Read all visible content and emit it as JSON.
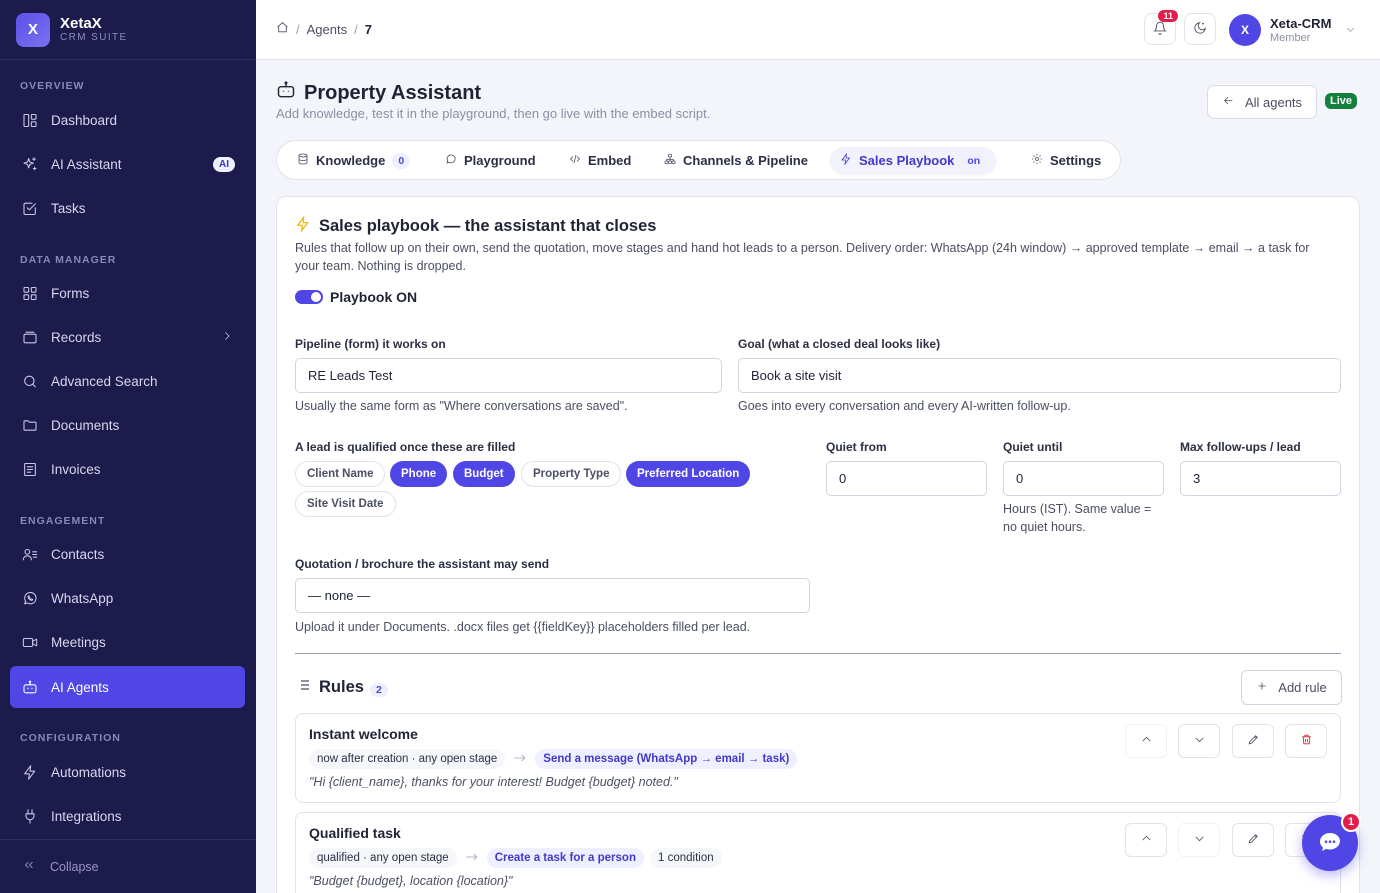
{
  "brand": {
    "logo_letter": "X",
    "name": "XetaX",
    "sub": "CRM SUITE"
  },
  "sidebar": {
    "sections": {
      "overview": "OVERVIEW",
      "data_manager": "DATA MANAGER",
      "engagement": "ENGAGEMENT",
      "configuration": "CONFIGURATION"
    },
    "items": {
      "dashboard": "Dashboard",
      "ai_assistant": "AI Assistant",
      "ai_badge": "AI",
      "tasks": "Tasks",
      "forms": "Forms",
      "records": "Records",
      "advanced_search": "Advanced Search",
      "documents": "Documents",
      "invoices": "Invoices",
      "contacts": "Contacts",
      "whatsapp": "WhatsApp",
      "meetings": "Meetings",
      "ai_agents": "AI Agents",
      "automations": "Automations",
      "integrations": "Integrations"
    },
    "collapse": "Collapse"
  },
  "header": {
    "breadcrumb": {
      "agents": "Agents",
      "current": "7"
    },
    "notifications_count": "11",
    "user": {
      "initial": "X",
      "name": "Xeta-CRM",
      "role": "Member"
    }
  },
  "page": {
    "title": "Property Assistant",
    "subtitle": "Add knowledge, test it in the playground, then go live with the embed script.",
    "all_agents": "All agents",
    "status": "Live"
  },
  "tabs": {
    "knowledge": {
      "label": "Knowledge",
      "count": "0"
    },
    "playground": {
      "label": "Playground"
    },
    "embed": {
      "label": "Embed"
    },
    "channels": {
      "label": "Channels & Pipeline"
    },
    "sales_playbook": {
      "label": "Sales Playbook",
      "badge": "on"
    },
    "settings": {
      "label": "Settings"
    }
  },
  "playbook": {
    "title": "Sales playbook — the assistant that closes",
    "description": "Rules that follow up on their own, send the quotation, move stages and hand hot leads to a person. Delivery order: WhatsApp (24h window) → approved template → email → a task for your team. Nothing is dropped.",
    "toggle_label": "Playbook ON",
    "pipeline": {
      "label": "Pipeline (form) it works on",
      "value": "RE Leads Test",
      "hint": "Usually the same form as \"Where conversations are saved\"."
    },
    "goal": {
      "label": "Goal (what a closed deal looks like)",
      "value": "Book a site visit",
      "hint": "Goes into every conversation and every AI-written follow-up."
    },
    "qualified": {
      "label": "A lead is qualified once these are filled",
      "fields": {
        "client_name": "Client Name",
        "phone": "Phone",
        "budget": "Budget",
        "property_type": "Property Type",
        "preferred_location": "Preferred Location",
        "site_visit_date": "Site Visit Date"
      }
    },
    "quiet_from": {
      "label": "Quiet from",
      "value": "0"
    },
    "quiet_until": {
      "label": "Quiet until",
      "value": "0",
      "hint": "Hours (IST). Same value = no quiet hours."
    },
    "max_followups": {
      "label": "Max follow-ups / lead",
      "value": "3"
    },
    "quotation": {
      "label": "Quotation / brochure the assistant may send",
      "value": "— none —",
      "hint": "Upload it under Documents. .docx files get {{fieldKey}} placeholders filled per lead."
    }
  },
  "rules": {
    "title": "Rules",
    "count": "2",
    "add_label": "Add rule",
    "items": [
      {
        "name": "Instant welcome",
        "trigger": "now after creation · any open stage",
        "action": "Send a message (WhatsApp → email → task)",
        "quote": "\"Hi {client_name}, thanks for your interest! Budget {budget} noted.\""
      },
      {
        "name": "Qualified task",
        "trigger": "qualified · any open stage",
        "action": "Create a task for a person",
        "conditions": "1 condition",
        "quote": "\"Budget {budget}, location {location}\""
      }
    ]
  },
  "chat_fab": {
    "count": "1"
  },
  "colors": {
    "accent": "#4f46e5",
    "sidebar": "#1d1a4c",
    "live": "#15803d",
    "danger": "#dc2626"
  }
}
